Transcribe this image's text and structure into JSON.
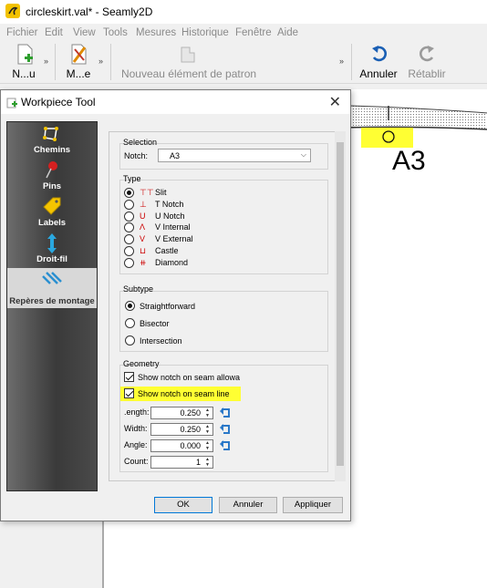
{
  "window": {
    "title": "circleskirt.val* - Seamly2D"
  },
  "menu": [
    "Fichier",
    "Edit",
    "View",
    "Tools",
    "Mesures",
    "Historique",
    "Fenêtre",
    "Aide"
  ],
  "toolbar": {
    "new_label": "N...u",
    "new_more": "»",
    "measure_label": "M...e",
    "measure_more": "»",
    "new_piece_label": "Nouveau élément de patron",
    "overflow": "»",
    "undo_label": "Annuler",
    "redo_label": "Rétablir"
  },
  "canvas": {
    "point_label": "A3"
  },
  "dialog": {
    "title": "Workpiece Tool",
    "close": "✕",
    "sidebar": [
      {
        "label": "Chemins",
        "icon": "paths-icon"
      },
      {
        "label": "Pins",
        "icon": "pin-icon"
      },
      {
        "label": "Labels",
        "icon": "label-tag-icon"
      },
      {
        "label": "Droit-fil",
        "icon": "grainline-icon"
      },
      {
        "label": "Repères de montage",
        "icon": "notches-icon",
        "selected": true
      }
    ],
    "selection": {
      "title": "Selection",
      "notch_label": "Notch:",
      "notch_value": "A3"
    },
    "type": {
      "title": "Type",
      "options": [
        {
          "label": "Slit",
          "symbol": "⊤⊤",
          "selected": true
        },
        {
          "label": "T Notch",
          "symbol": "⊥",
          "selected": false
        },
        {
          "label": "U Notch",
          "symbol": "U",
          "selected": false
        },
        {
          "label": "V Internal",
          "symbol": "Λ",
          "selected": false
        },
        {
          "label": "V External",
          "symbol": "V",
          "selected": false
        },
        {
          "label": "Castle",
          "symbol": "⊔",
          "selected": false
        },
        {
          "label": "Diamond",
          "symbol": "⧺",
          "selected": false
        }
      ]
    },
    "subtype": {
      "title": "Subtype",
      "options": [
        {
          "label": "Straightforward",
          "selected": true
        },
        {
          "label": "Bisector",
          "selected": false
        },
        {
          "label": "Intersection",
          "selected": false
        }
      ]
    },
    "geometry": {
      "title": "Geometry",
      "show_on_allowance": {
        "label": "Show notch on seam allowa",
        "checked": true
      },
      "show_on_seam": {
        "label": "Show notch on seam line",
        "checked": true
      },
      "length": {
        "label": ".ength:",
        "value": "0.250"
      },
      "width": {
        "label": "Width:",
        "value": "0.250"
      },
      "angle": {
        "label": "Angle:",
        "value": "0.000"
      },
      "count": {
        "label": "Count:",
        "value": "1"
      }
    },
    "buttons": {
      "ok": "OK",
      "cancel": "Annuler",
      "apply": "Appliquer"
    }
  },
  "colors": {
    "highlight": "#ffff33",
    "notch_symbol": "#cc0000",
    "undo": "#1a5fb4"
  }
}
